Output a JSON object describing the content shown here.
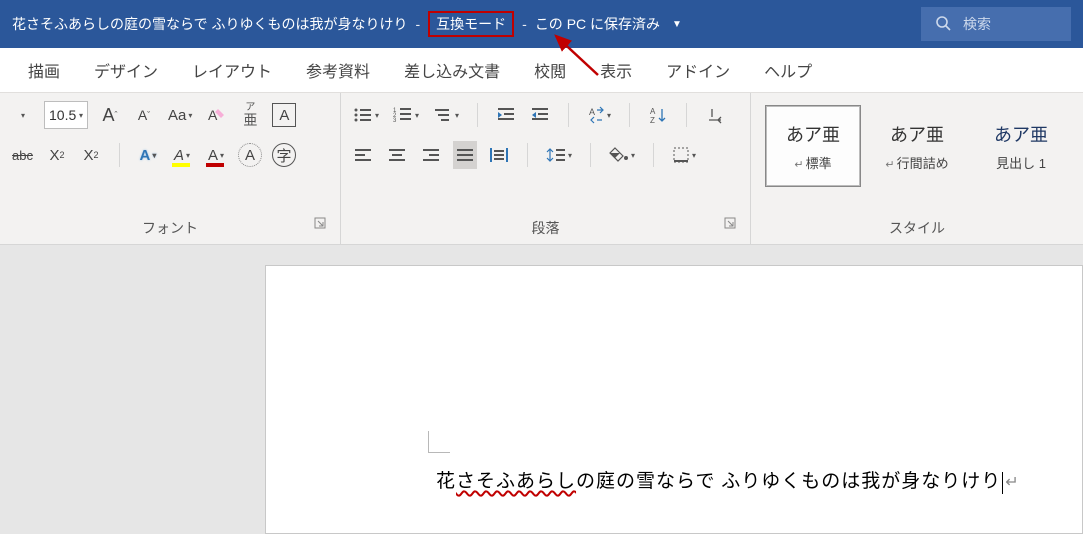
{
  "title": {
    "doc_name": "花さそふあらしの庭の雪ならで ふりゆくものは我が身なりけり",
    "compat_mode": "互換モード",
    "save_status": "この PC に保存済み",
    "search_placeholder": "検索"
  },
  "tabs": [
    "描画",
    "デザイン",
    "レイアウト",
    "参考資料",
    "差し込み文書",
    "校閲",
    "表示",
    "アドイン",
    "ヘルプ"
  ],
  "font_group": {
    "label": "フォント",
    "size": "10.5",
    "grow": "A",
    "shrink": "A",
    "change_case": "Aa",
    "clear_fmt": "A",
    "phonetic1": "ア",
    "phonetic2": "亜",
    "char_border": "A",
    "strike_glyph": "abc",
    "subscript": "X",
    "sub_small": "2",
    "superscript": "X",
    "sup_small": "2",
    "text_effects": "A",
    "highlight": "A",
    "font_color": "A",
    "circle": "A",
    "enclose": "字"
  },
  "para_group": {
    "label": "段落"
  },
  "style_group": {
    "label": "スタイル",
    "items": [
      {
        "sample": "あア亜",
        "caption": "標準",
        "pm": true,
        "selected": true
      },
      {
        "sample": "あア亜",
        "caption": "行間詰め",
        "pm": true,
        "selected": false
      },
      {
        "sample": "あア亜",
        "caption": "見出し 1",
        "pm": false,
        "selected": false,
        "h1": true
      }
    ]
  },
  "document": {
    "text_prefix": "花",
    "text_squiggle": "さそふあらし",
    "text_suffix": "の庭の雪ならで  ふりゆくものは我が身なりけり"
  }
}
